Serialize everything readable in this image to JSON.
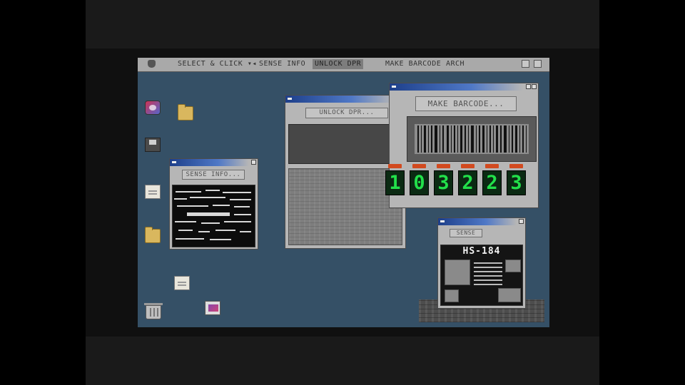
{
  "menubar": {
    "select_click": "SELECT & CLICK",
    "select_click_arrow": "▾◂",
    "items": [
      "SENSE INFO",
      "UNLOCK DPR",
      "MAKE BARCODE",
      "ARCH"
    ]
  },
  "windows": {
    "sense_info": {
      "button_label": "SENSE INFO..."
    },
    "unlock_dpr": {
      "button_label": "UNLOCK DPR..."
    },
    "make_barcode": {
      "button_label": "MAKE  BARCODE...",
      "digits": [
        "1",
        "0",
        "3",
        "2",
        "2",
        "3"
      ]
    },
    "hs184": {
      "button_label": "SENSE",
      "title": "HS-184"
    }
  },
  "colors": {
    "desktop": "#355066",
    "menubar": "#a9a9a9",
    "titlebar": "#1d3f8a",
    "digit_glow": "#22e04a",
    "led": "#d24a1f"
  }
}
